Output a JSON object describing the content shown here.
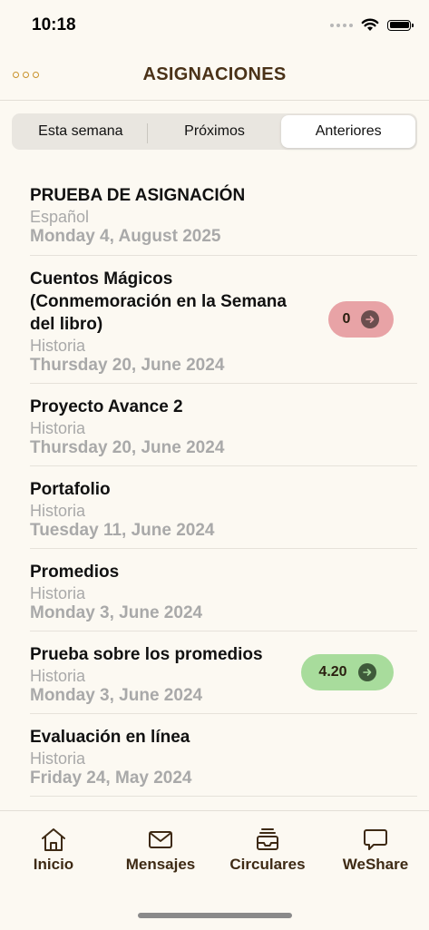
{
  "status": {
    "time": "10:18"
  },
  "header": {
    "title": "ASIGNACIONES"
  },
  "segments": [
    "Esta semana",
    "Próximos",
    "Anteriores"
  ],
  "assignments": [
    {
      "title": "PRUEBA DE ASIGNACIÓN",
      "subject": "Español",
      "date": "Monday 4, August 2025"
    },
    {
      "title": "Cuentos Mágicos (Conmemoración en la Semana del libro)",
      "title_lines": [
        "Cuentos Mágicos",
        "(Conmemoración en la Semana",
        "del libro)"
      ],
      "subject": "Historia",
      "date": "Thursday 20, June 2024",
      "badge": "0"
    },
    {
      "title": "Proyecto Avance 2",
      "subject": "Historia",
      "date": "Thursday 20, June 2024"
    },
    {
      "title": "Portafolio",
      "subject": "Historia",
      "date": "Tuesday 11, June 2024"
    },
    {
      "title": "Promedios",
      "subject": "Historia",
      "date": "Monday 3, June 2024"
    },
    {
      "title": "Prueba sobre los promedios",
      "subject": "Historia",
      "date": "Monday 3, June 2024",
      "badge": "4.20"
    },
    {
      "title": "Evaluación en línea",
      "subject": "Historia",
      "date": "Friday 24, May 2024"
    }
  ],
  "tabs": {
    "home": "Inicio",
    "messages": "Mensajes",
    "circulars": "Circulares",
    "weshare": "WeShare"
  },
  "colors": {
    "accent": "#c9922a",
    "title": "#4a3218",
    "badge_red": "#e8a3a6",
    "badge_green": "#a8dc9c",
    "background": "#fcf9f2"
  }
}
